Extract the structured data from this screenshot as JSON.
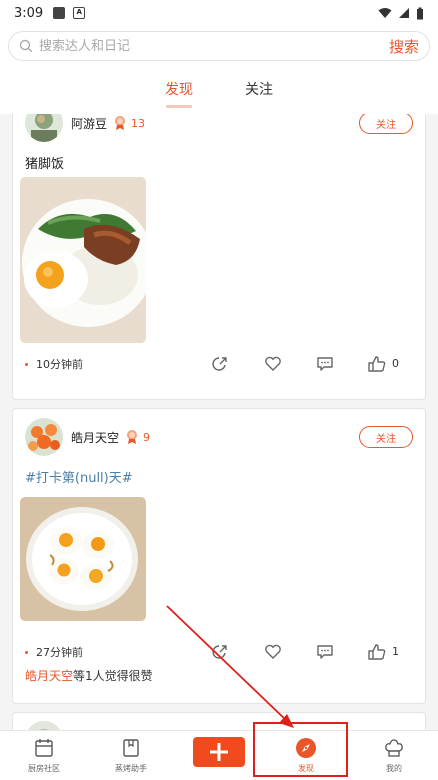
{
  "status_bar": {
    "time": "3:09",
    "notif_letter": "A"
  },
  "search": {
    "placeholder": "搜索达人和日记",
    "button_label": "搜索"
  },
  "tabs": [
    {
      "label": "发现",
      "active": true
    },
    {
      "label": "关注",
      "active": false
    }
  ],
  "posts": [
    {
      "username": "阿游豆",
      "level": "13",
      "follow_label": "关注",
      "title": "猪脚饭",
      "time_ago": "10分钟前",
      "like_count": "0",
      "photo": "pork-rice-with-fried-egg"
    },
    {
      "username": "皓月天空",
      "level": "9",
      "follow_label": "关注",
      "title": "#打卡第(null)天#",
      "time_ago": "27分钟前",
      "like_count": "1",
      "photo": "fried-eggs-on-plate",
      "liked_by_name": "皓月天空",
      "liked_by_suffix": "等1人觉得很赞"
    }
  ],
  "bottom_nav": [
    {
      "label": "厨房社区",
      "icon": "calendar-icon",
      "active": false
    },
    {
      "label": "蒸烤助手",
      "icon": "book-icon",
      "active": false
    },
    {
      "label": "",
      "icon": "plus-icon",
      "active": false
    },
    {
      "label": "发现",
      "icon": "compass-icon",
      "active": true
    },
    {
      "label": "我的",
      "icon": "chef-hat-icon",
      "active": false
    }
  ],
  "colors": {
    "accent": "#e8562a",
    "tag_blue": "#4a7fa8",
    "annotation_red": "#e0201a"
  }
}
